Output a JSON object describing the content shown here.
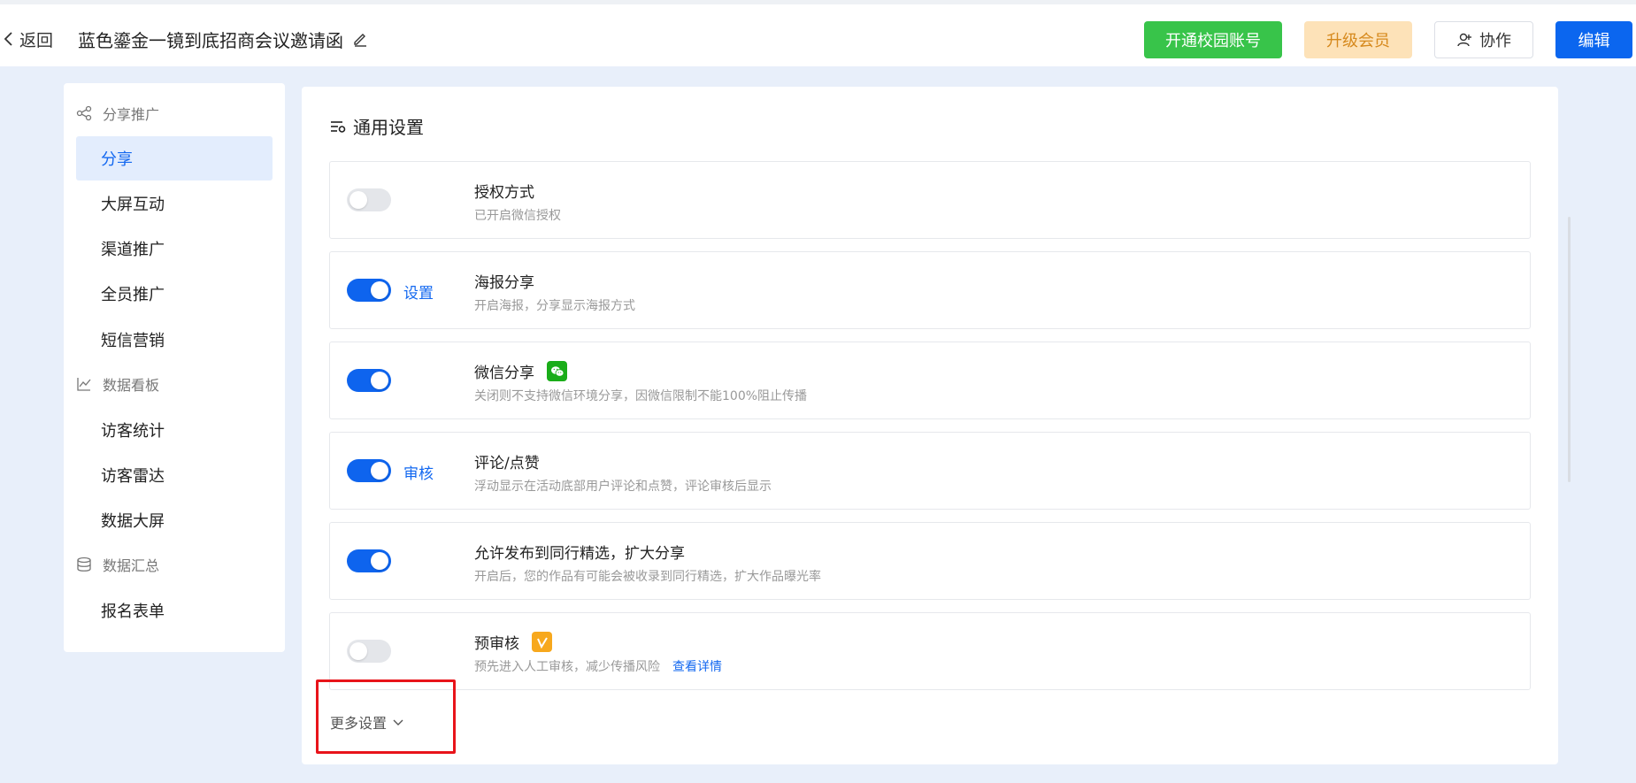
{
  "header": {
    "back_label": "返回",
    "title": "蓝色鎏金一镜到底招商会议邀请函",
    "buttons": {
      "campus": "开通校园账号",
      "vip": "升级会员",
      "collab": "协作",
      "edit": "编辑"
    }
  },
  "sidebar": {
    "groups": [
      {
        "label": "分享推广",
        "icon": "share-icon"
      },
      {
        "label": "数据看板",
        "icon": "line-chart-icon"
      },
      {
        "label": "数据汇总",
        "icon": "database-icon"
      }
    ],
    "items": [
      {
        "label": "分享",
        "active": true
      },
      {
        "label": "大屏互动"
      },
      {
        "label": "渠道推广"
      },
      {
        "label": "全员推广"
      },
      {
        "label": "短信营销"
      },
      {
        "label": "访客统计"
      },
      {
        "label": "访客雷达"
      },
      {
        "label": "数据大屏"
      },
      {
        "label": "报名表单"
      }
    ]
  },
  "main": {
    "section_title": "通用设置",
    "settings": [
      {
        "label": "授权方式",
        "desc": "已开启微信授权",
        "enabled": false
      },
      {
        "label": "海报分享",
        "desc": "开启海报，分享显示海报方式",
        "enabled": true,
        "link": "设置"
      },
      {
        "label": "微信分享",
        "desc": "关闭则不支持微信环境分享，因微信限制不能100%阻止传播",
        "enabled": true,
        "icon": "wechat-icon"
      },
      {
        "label": "评论/点赞",
        "desc": "浮动显示在活动底部用户评论和点赞，评论审核后显示",
        "enabled": true,
        "link": "审核"
      },
      {
        "label": "允许发布到同行精选，扩大分享",
        "desc": "开启后，您的作品有可能会被收录到同行精选，扩大作品曝光率",
        "enabled": true
      },
      {
        "label": "预审核",
        "desc": "预先进入人工审核，减少传播风险",
        "enabled": false,
        "icon": "vip-icon",
        "desc_link": "查看详情"
      }
    ],
    "more_label": "更多设置"
  },
  "colors": {
    "primary": "#0e64ee",
    "green": "#38c44a",
    "vip_bg": "#fde2b8",
    "highlight": "#e8141a"
  }
}
